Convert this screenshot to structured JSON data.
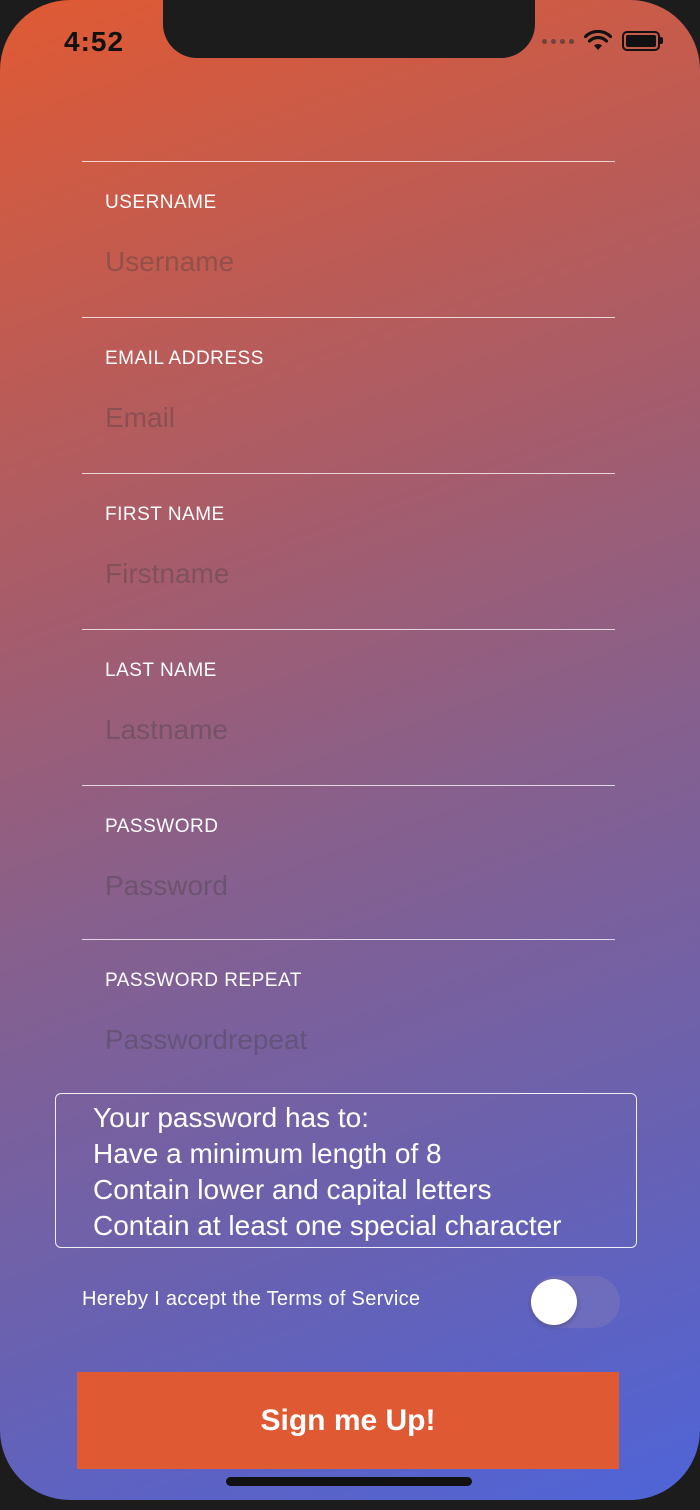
{
  "status_bar": {
    "time": "4:52",
    "icons": [
      "signal-dots-icon",
      "wifi-icon",
      "battery-icon"
    ]
  },
  "form": {
    "fields": [
      {
        "label": "USERNAME",
        "placeholder": "Username",
        "value": ""
      },
      {
        "label": "EMAIL ADDRESS",
        "placeholder": "Email",
        "value": ""
      },
      {
        "label": "FIRST NAME",
        "placeholder": "Firstname",
        "value": ""
      },
      {
        "label": "LAST NAME",
        "placeholder": "Lastname",
        "value": ""
      },
      {
        "label": "PASSWORD",
        "placeholder": "Password",
        "value": ""
      },
      {
        "label": "PASSWORD REPEAT",
        "placeholder": "Passwordrepeat",
        "value": ""
      }
    ],
    "password_rules": [
      "Your password has to:",
      "Have a minimum length of 8",
      "Contain lower and capital letters",
      "Contain at least one special character"
    ],
    "terms_label": "Hereby I accept the Terms of Service",
    "terms_accepted": false,
    "submit_label": "Sign me Up!"
  },
  "colors": {
    "accent": "#df5a33",
    "gradient_top": "#e05a33",
    "gradient_bottom": "#4f64d8"
  }
}
